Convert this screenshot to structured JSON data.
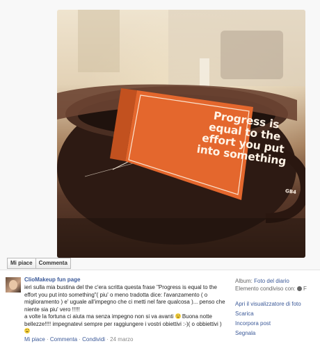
{
  "photo": {
    "tag_lines": [
      "Progress is",
      "equal to the",
      "effort you put",
      "into something"
    ],
    "tag_brand": "GB4"
  },
  "photo_actions": {
    "like_label": "Mi piace",
    "comment_label": "Commenta"
  },
  "post": {
    "author": "ClioMakeup fun page",
    "text_part1": "ieri sulla mia bustina del the c'era scritta questa frase \"Progress is equal to the effort you put into something\"( piu' o meno tradotta dice: l'avanzamento ( o miglioramento ) e' uguale all'impegno che ci metti nel fare qualcosa )... penso che niente sia piu' vero !!!!!\na volte la fortuna ci aiuta ma senza impegno non si va avanti",
    "text_part2": " Buona notte bellezze!!!! impegnatevi sempre per raggiungere i vostri obiettivi :-)( o obbiettivi )",
    "links": {
      "like": "Mi piace",
      "comment": "Commenta",
      "share": "Condividi",
      "date": "24 marzo",
      "separator": " · "
    }
  },
  "sidebar": {
    "album_label": "Album:",
    "album_value": "Foto del diario",
    "shared_label": "Elemento condiviso con:",
    "shared_trail": "F",
    "actions": [
      "Apri il visualizzatore di foto",
      "Scarica",
      "Incorpora post",
      "Segnala"
    ]
  }
}
